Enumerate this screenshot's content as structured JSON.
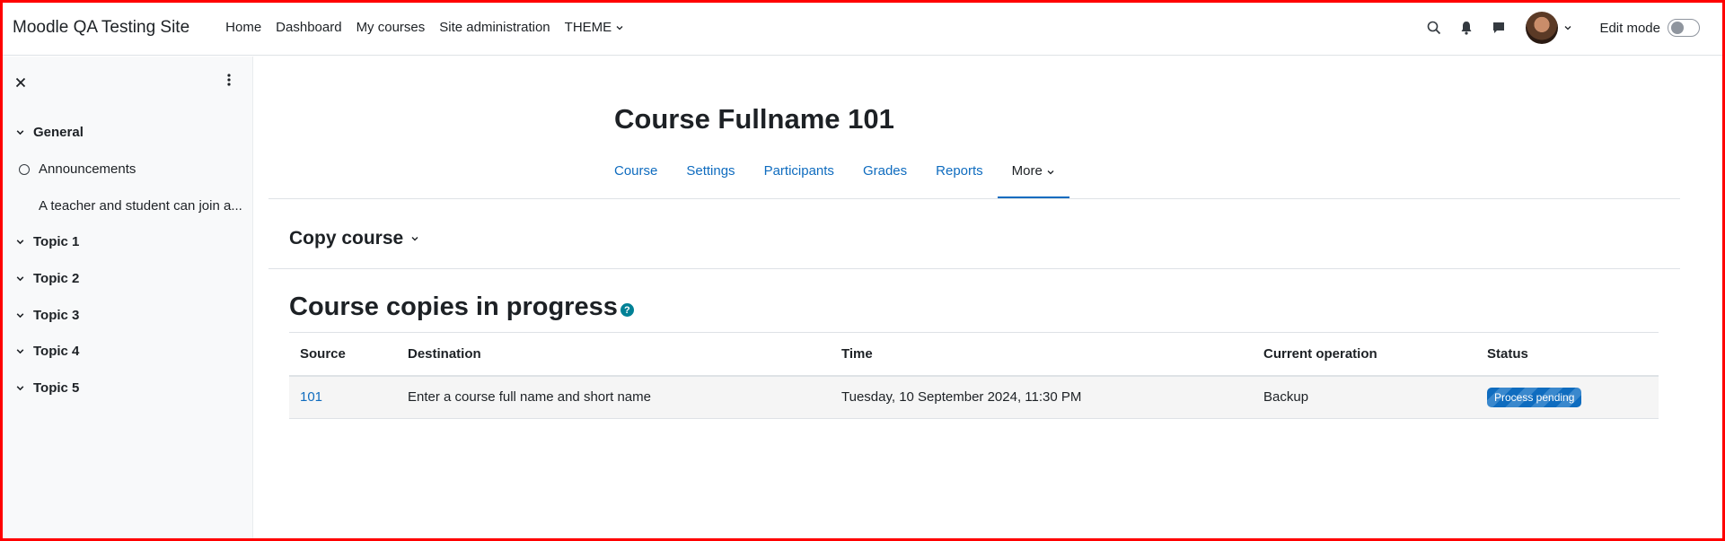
{
  "site": {
    "brand": "Moodle QA Testing Site"
  },
  "primary_nav": [
    {
      "label": "Home"
    },
    {
      "label": "Dashboard"
    },
    {
      "label": "My courses"
    },
    {
      "label": "Site administration"
    },
    {
      "label": "THEME",
      "has_dropdown": true
    }
  ],
  "header_right": {
    "icons": [
      "search-icon",
      "bell-icon",
      "chat-icon"
    ],
    "edit_mode_label": "Edit mode",
    "edit_mode_on": false
  },
  "drawer": {
    "items": [
      {
        "type": "section",
        "label": "General"
      },
      {
        "type": "activity",
        "label": "Announcements"
      },
      {
        "type": "subtext",
        "label": "A teacher and student can join a..."
      },
      {
        "type": "section",
        "label": "Topic 1"
      },
      {
        "type": "section",
        "label": "Topic 2"
      },
      {
        "type": "section",
        "label": "Topic 3"
      },
      {
        "type": "section",
        "label": "Topic 4"
      },
      {
        "type": "section",
        "label": "Topic 5"
      }
    ]
  },
  "course": {
    "title": "Course Fullname 101"
  },
  "secondary_nav": [
    {
      "label": "Course"
    },
    {
      "label": "Settings"
    },
    {
      "label": "Participants"
    },
    {
      "label": "Grades"
    },
    {
      "label": "Reports"
    },
    {
      "label": "More",
      "active": true
    }
  ],
  "page": {
    "selector_heading": "Copy course",
    "heading": "Course copies in progress"
  },
  "table": {
    "headers": [
      "Source",
      "Destination",
      "Time",
      "Current operation",
      "Status"
    ],
    "rows": [
      {
        "source": "101",
        "destination": "Enter a course full name and short name",
        "time": "Tuesday, 10 September 2024, 11:30 PM",
        "operation": "Backup",
        "status": "Process pending"
      }
    ]
  },
  "colors": {
    "link": "#0f6cbf",
    "help": "#008196",
    "frame": "#ff0000"
  }
}
